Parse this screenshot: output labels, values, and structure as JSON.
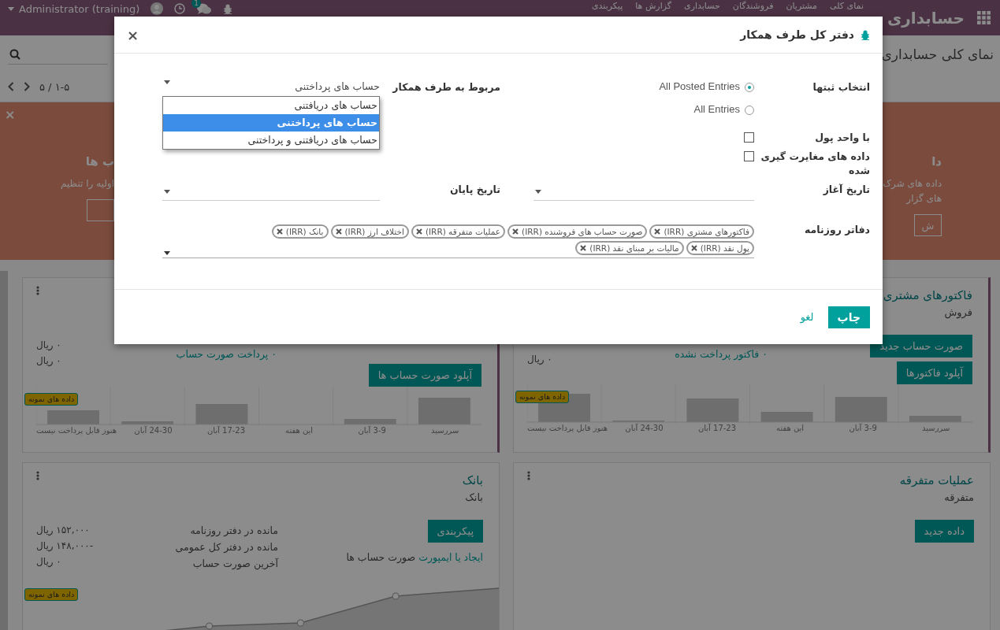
{
  "topbar": {
    "brand": "حسابداری",
    "menu": [
      "نمای کلی",
      "مشتریان",
      "فروشندگان",
      "حسابداری",
      "گزارش ها",
      "پیکربندی"
    ],
    "user": "Administrator (training)",
    "chat_badge": "1"
  },
  "control_panel": {
    "breadcrumb": "نمای کلی حسابداری",
    "pager": "۱-۵ / ۵"
  },
  "banner": {
    "close": "×",
    "steps": [
      {
        "title": "دا",
        "lines": [
          "داده های شرک",
          "های گزار"
        ],
        "button": "ش"
      },
      {
        "title": "ب ها",
        "lines": [
          "اولیه را تنظیم"
        ]
      }
    ]
  },
  "journals": [
    {
      "kind": "sales",
      "title": "فاکتورهای مشتری",
      "subtitle": "فروش",
      "buttons": [
        "صورت حساب جدید",
        "آپلود فاکتورها"
      ],
      "links": [
        "۰ فاکتور پرداخت نشده"
      ],
      "amounts": [
        "۰ ریال"
      ],
      "badge": "داده های نمونه",
      "chart_labels": [
        "سررسید",
        "3-9 آبان",
        "این هفته",
        "17-23 آبان",
        "24-30 آبان",
        "هنوز قابل پرداخت نیست"
      ]
    },
    {
      "kind": "purchase",
      "buttons": [
        "آپلود صورت حساب ها"
      ],
      "links": [
        "۰ پرداخت صورت حساب"
      ],
      "amounts": [
        "۰ ریال",
        "۰ ریال"
      ],
      "badge": "داده های نمونه",
      "chart_labels": [
        "سررسید",
        "3-9 آبان",
        "این هفته",
        "17-23 آبان",
        "24-30 آبان",
        "هنوز قابل پرداخت نیست"
      ]
    },
    {
      "kind": "general",
      "title": "عملیات متفرقه",
      "subtitle": "متفرقه",
      "buttons": [
        "داده جدید"
      ]
    },
    {
      "kind": "bank",
      "title": "بانک",
      "subtitle": "بانک",
      "buttons": [
        "پیکربندی"
      ],
      "note_link": "ایجاد یا ایمپورت",
      "note": "صورت حساب ها",
      "stats": [
        {
          "label": "مانده در دفتر روزنامه",
          "value": "۱۵۲,۰۰۰ ریال"
        },
        {
          "label": "مانده در دفتر کل عمومی",
          "value": "-۱۴۸,۰۰۰ ریال"
        },
        {
          "label": "آخرین صورت حساب",
          "value": "۰ ریال"
        }
      ],
      "badge": "داده های نمونه"
    }
  ],
  "dialog": {
    "title": "دفتر کل طرف همکار",
    "close": "×",
    "target_label": "انتخاب ثبتها",
    "target_options": [
      {
        "label": "All Posted Entries",
        "selected": true
      },
      {
        "label": "All Entries",
        "selected": false
      }
    ],
    "partner_label": "مربوط به طرف همکار",
    "partner_value": "حساب های پرداختنی",
    "partner_options": [
      {
        "label": "حساب های دریافتنی",
        "selected": false
      },
      {
        "label": "حساب های پرداختنی",
        "selected": true
      },
      {
        "label": "حساب های دریافتنی و پرداختنی",
        "selected": false
      }
    ],
    "checks": [
      {
        "label": "با واحد پول",
        "checked": false
      },
      {
        "label": "داده های مغایرت گیری شده",
        "checked": false
      }
    ],
    "date_from_label": "تاریخ آغاز",
    "date_to_label": "تاریخ پایان",
    "journals_label": "دفاتر روزنامه",
    "journals": [
      "فاکتورهای مشتری (IRR)",
      "صورت حساب های فروشنده (IRR)",
      "عملیات متفرقه (IRR)",
      "اختلاف ارز (IRR)",
      "بانک (IRR)",
      "پول نقد (IRR)",
      "مالیات بر مبنای نقد (IRR)"
    ],
    "buttons": [
      {
        "label": "چاپ",
        "kind": "primary"
      },
      {
        "label": "لغو",
        "kind": "link"
      }
    ]
  }
}
